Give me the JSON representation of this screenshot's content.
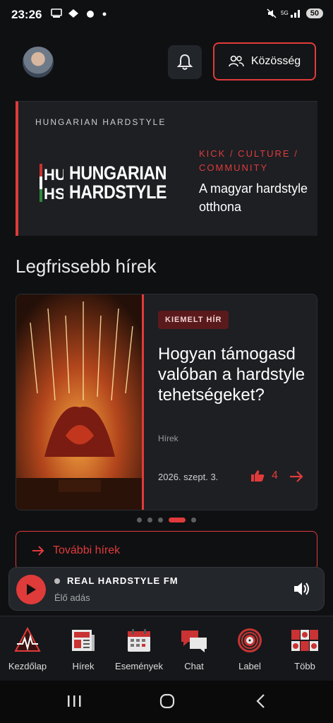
{
  "status": {
    "time": "23:26",
    "battery": "50"
  },
  "header": {
    "community_label": "Közösség"
  },
  "hero": {
    "kicker": "HUNGARIAN HARDSTYLE",
    "logo_line1": "HUNGARIAN",
    "logo_line2": "HARDSTYLE",
    "tagline": "KICK  /  CULTURE  /  COMMUNITY",
    "subtitle": "A magyar hardstyle otthona"
  },
  "news": {
    "section_title": "Legfrissebb hírek",
    "badge": "KIEMELT HÍR",
    "title": "Hogyan támogasd valóban a hardstyle tehetségeket?",
    "category": "Hírek",
    "date": "2026. szept. 3.",
    "likes": "4",
    "carousel_index": 3,
    "carousel_count": 5,
    "more_label": "További hírek"
  },
  "player": {
    "station": "REAL HARDSTYLE FM",
    "status": "Élő adás"
  },
  "tabs": [
    {
      "label": "Kezdőlap",
      "icon": "home-pulse-icon"
    },
    {
      "label": "Hírek",
      "icon": "newspaper-icon"
    },
    {
      "label": "Események",
      "icon": "calendar-icon"
    },
    {
      "label": "Chat",
      "icon": "chat-icon"
    },
    {
      "label": "Label",
      "icon": "vinyl-icon"
    },
    {
      "label": "Több",
      "icon": "more-grid-icon"
    }
  ],
  "colors": {
    "accent": "#e03b3b",
    "background": "#0f1012",
    "card": "#1d1f23"
  }
}
